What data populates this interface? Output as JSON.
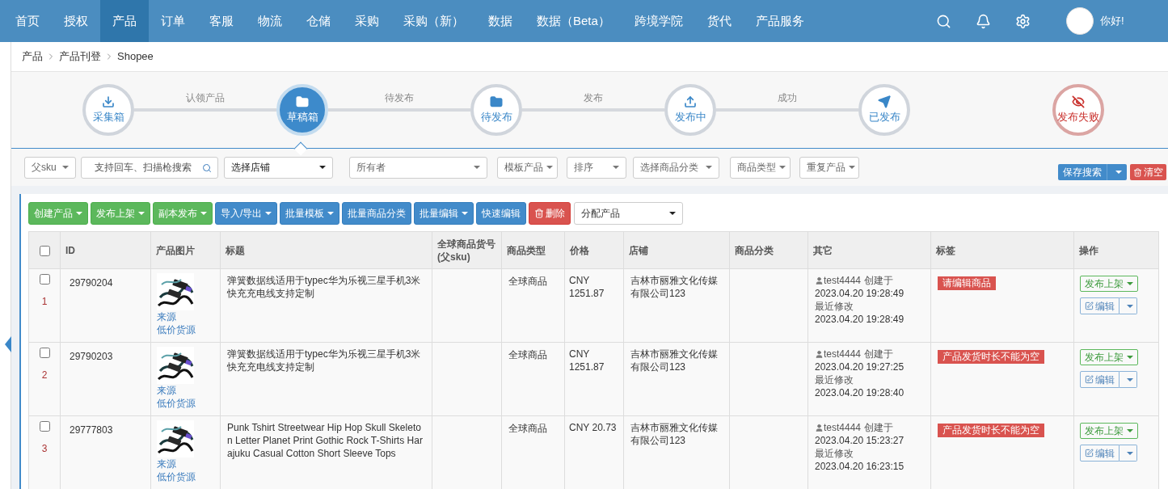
{
  "nav": {
    "items": [
      {
        "label": "首页",
        "selected": false
      },
      {
        "label": "授权",
        "selected": false
      },
      {
        "label": "产品",
        "selected": true
      },
      {
        "label": "订单",
        "selected": false
      },
      {
        "label": "客服",
        "selected": false
      },
      {
        "label": "物流",
        "selected": false
      },
      {
        "label": "仓储",
        "selected": false
      },
      {
        "label": "采购",
        "selected": false
      },
      {
        "label": "采购（新）",
        "selected": false
      },
      {
        "label": "数据",
        "selected": false
      },
      {
        "label": "数据（Beta）",
        "selected": false
      },
      {
        "label": "跨境学院",
        "selected": false
      },
      {
        "label": "货代",
        "selected": false
      },
      {
        "label": "产品服务",
        "selected": false
      }
    ],
    "greeting": "你好!"
  },
  "breadcrumb": [
    "产品",
    "产品刊登",
    "Shopee"
  ],
  "steps": [
    {
      "label": "采集箱",
      "kind": "download",
      "selected": false,
      "next": "认领产品"
    },
    {
      "label": "草稿箱",
      "kind": "folder",
      "selected": true,
      "next": "待发布"
    },
    {
      "label": "待发布",
      "kind": "folder",
      "selected": false,
      "next": "发布"
    },
    {
      "label": "发布中",
      "kind": "upload",
      "selected": false,
      "next": "成功"
    },
    {
      "label": "已发布",
      "kind": "send",
      "selected": false
    },
    {
      "label": "发布失败",
      "kind": "failed",
      "selected": false
    }
  ],
  "filters": [
    {
      "kind": "select",
      "label": "父sku"
    },
    {
      "kind": "search",
      "placeholder": "支持回车、扫描枪搜索"
    },
    {
      "kind": "dark-select",
      "label": "选择店铺"
    },
    {
      "kind": "wide-select",
      "label": "所有者"
    },
    {
      "kind": "select",
      "label": "模板产品"
    },
    {
      "kind": "select",
      "label": "排序"
    },
    {
      "kind": "select",
      "label": "选择商品分类"
    },
    {
      "kind": "select",
      "label": "商品类型"
    },
    {
      "kind": "select",
      "label": "重复产品"
    }
  ],
  "save_search": "保存搜索",
  "clear": "清空",
  "toolbar": [
    {
      "label": "创建产品",
      "kind": "success",
      "menu": true
    },
    {
      "label": "发布上架",
      "kind": "success",
      "menu": true
    },
    {
      "label": "副本发布",
      "kind": "success",
      "menu": true
    },
    {
      "label": "导入/导出",
      "kind": "primary",
      "menu": true
    },
    {
      "label": "批量模板",
      "kind": "primary",
      "menu": true
    },
    {
      "label": "批量商品分类",
      "kind": "primary",
      "menu": false
    },
    {
      "label": "批量编辑",
      "kind": "primary",
      "menu": true
    },
    {
      "label": "快速编辑",
      "kind": "primary",
      "menu": false
    },
    {
      "label": "删除",
      "kind": "danger",
      "menu": false
    }
  ],
  "assign": "分配产品",
  "table": {
    "select_all": false,
    "columns": [
      "ID",
      "产品图片",
      "标题",
      "全球商品货号\n(父sku)",
      "商品类型",
      "价格",
      "店铺",
      "商品分类",
      "其它",
      "标签",
      "操作"
    ],
    "rows": [
      {
        "checked": false,
        "index": "1",
        "id": "29790204",
        "links": [
          "来源",
          "低价货源"
        ],
        "title": "弹簧数据线适用于typec华为乐视三星手机3米快充充电线支持定制",
        "type": "全球商品",
        "price": "CNY 1251.87",
        "shop": "吉林市丽雅文化传媒有限公司123",
        "user": "test4444",
        "created_label": "创建于",
        "created": "2023.04.20 19:28:49",
        "modified_label": "最近修改",
        "modified": "2023.04.20 19:28:49",
        "tag": "请编辑商品",
        "publish": "发布上架",
        "edit": "编辑"
      },
      {
        "checked": false,
        "index": "2",
        "id": "29790203",
        "links": [
          "来源",
          "低价货源"
        ],
        "title": "弹簧数据线适用于typec华为乐视三星手机3米快充充电线支持定制",
        "type": "全球商品",
        "price": "CNY 1251.87",
        "shop": "吉林市丽雅文化传媒有限公司123",
        "user": "test4444",
        "created_label": "创建于",
        "created": "2023.04.20 19:27:25",
        "modified_label": "最近修改",
        "modified": "2023.04.20 19:28:40",
        "tag": "产品发货时长不能为空",
        "publish": "发布上架",
        "edit": "编辑"
      },
      {
        "checked": false,
        "index": "3",
        "id": "29777803",
        "links": [
          "来源",
          "低价货源"
        ],
        "title": "Punk Tshirt Streetwear Hip Hop Skull Skeleton Letter Planet Print Gothic Rock T-Shirts Harajuku Casual Cotton Short Sleeve Tops",
        "type": "全球商品",
        "price": "CNY 20.73",
        "shop": "吉林市丽雅文化传媒有限公司123",
        "user": "test4444",
        "created_label": "创建于",
        "created": "2023.04.20 15:23:27",
        "modified_label": "最近修改",
        "modified": "2023.04.20 16:23:15",
        "tag": "产品发货时长不能为空",
        "publish": "发布上架",
        "edit": "编辑"
      }
    ]
  }
}
